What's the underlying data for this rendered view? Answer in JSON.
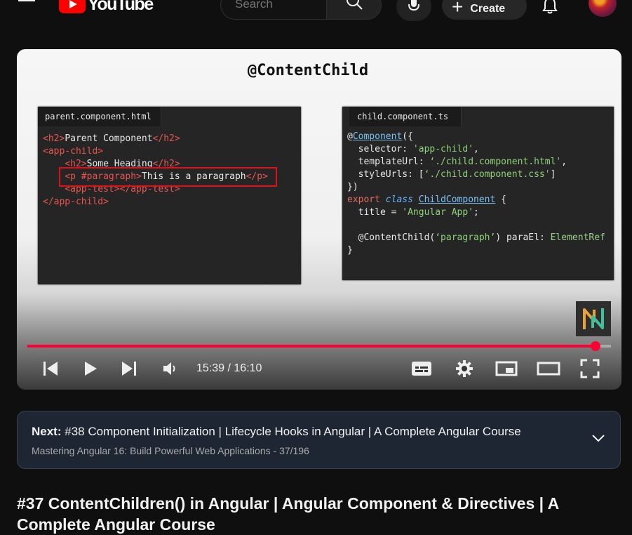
{
  "header": {
    "logo_text": "YouTube",
    "search_placeholder": "Search",
    "create_label": "Create"
  },
  "player": {
    "slide": {
      "title": "@ContentChild",
      "left_tab": "parent.component.html",
      "right_tab": "child.component.ts"
    },
    "current_time": "15:39",
    "separator": " / ",
    "duration": "16:10",
    "progress_fraction": 0.973,
    "progress_color": "#ff0033"
  },
  "up_next": {
    "prefix": "Next:",
    "title": "#38 Component Initialization | Lifecycle Hooks in Angular | A Complete Angular Course",
    "playlist": "Mastering Angular 16: Build Powerful Web Applications",
    "position": "37/196",
    "separator": " - "
  },
  "video": {
    "title": "#37 ContentChildren() in Angular | Angular Component & Directives | A Complete Angular Course"
  },
  "colors": {
    "brand_red": "#ff0000",
    "background": "#0f0f0f",
    "card_background": "#1e2533"
  }
}
